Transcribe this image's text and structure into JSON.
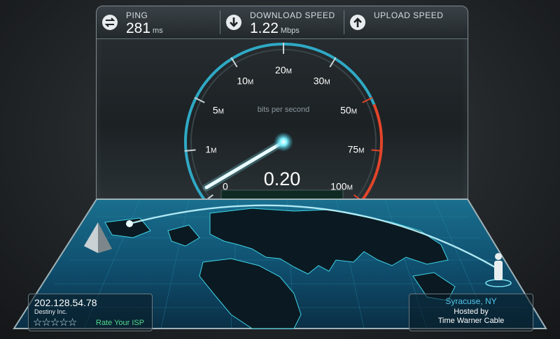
{
  "stats": {
    "ping": {
      "label": "PING",
      "value": "281",
      "unit": "ms",
      "icon": "ping-arrows-icon"
    },
    "download": {
      "label": "DOWNLOAD SPEED",
      "value": "1.22",
      "unit": "Mbps",
      "icon": "download-arrow-icon"
    },
    "upload": {
      "label": "UPLOAD SPEED",
      "value": "",
      "unit": "",
      "icon": "upload-arrow-icon"
    }
  },
  "gauge": {
    "caption": "bits per second",
    "reading": "0.20",
    "needle_value_mbps": 0.2,
    "ticks": [
      {
        "label": "0",
        "unit": ""
      },
      {
        "label": "1",
        "unit": "M"
      },
      {
        "label": "5",
        "unit": "M"
      },
      {
        "label": "10",
        "unit": "M"
      },
      {
        "label": "20",
        "unit": "M"
      },
      {
        "label": "30",
        "unit": "M"
      },
      {
        "label": "50",
        "unit": "M"
      },
      {
        "label": "75",
        "unit": "M"
      },
      {
        "label": "100",
        "unit": "M"
      }
    ],
    "colors": {
      "arc": "#2fa9c4",
      "redzone": "#e2452a",
      "needle": "#e9fbff"
    }
  },
  "client": {
    "ip": "202.128.54.78",
    "isp": "Destiny Inc.",
    "rating_stars": 5,
    "rating_filled": 0,
    "rate_label": "Rate Your ISP"
  },
  "server": {
    "city": "Syracuse, NY",
    "hosted_by_label": "Hosted by",
    "provider": "Time Warner Cable"
  }
}
